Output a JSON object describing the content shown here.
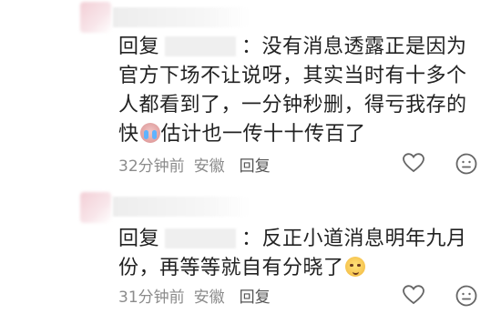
{
  "comments": [
    {
      "reply_prefix": "回复",
      "colon": "：",
      "text_part1": "没有消息透露正是因为官方下场不让说呀，其实当时有十多个人都看到了，一分钟秒删，得亏我存的快",
      "text_part2": "估计也一传十十传百了",
      "time": "32分钟前",
      "location": "安徽",
      "reply_action": "回复"
    },
    {
      "reply_prefix": "回复",
      "colon": "：",
      "text_part1": "反正小道消息明年九月份，再等等就自有分晓了",
      "time": "31分钟前",
      "location": "安徽",
      "reply_action": "回复"
    }
  ],
  "icons": {
    "heart": "heart-icon",
    "comment_face": "face-icon",
    "emoji1": "crying-emoji",
    "emoji2": "smug-emoji"
  }
}
